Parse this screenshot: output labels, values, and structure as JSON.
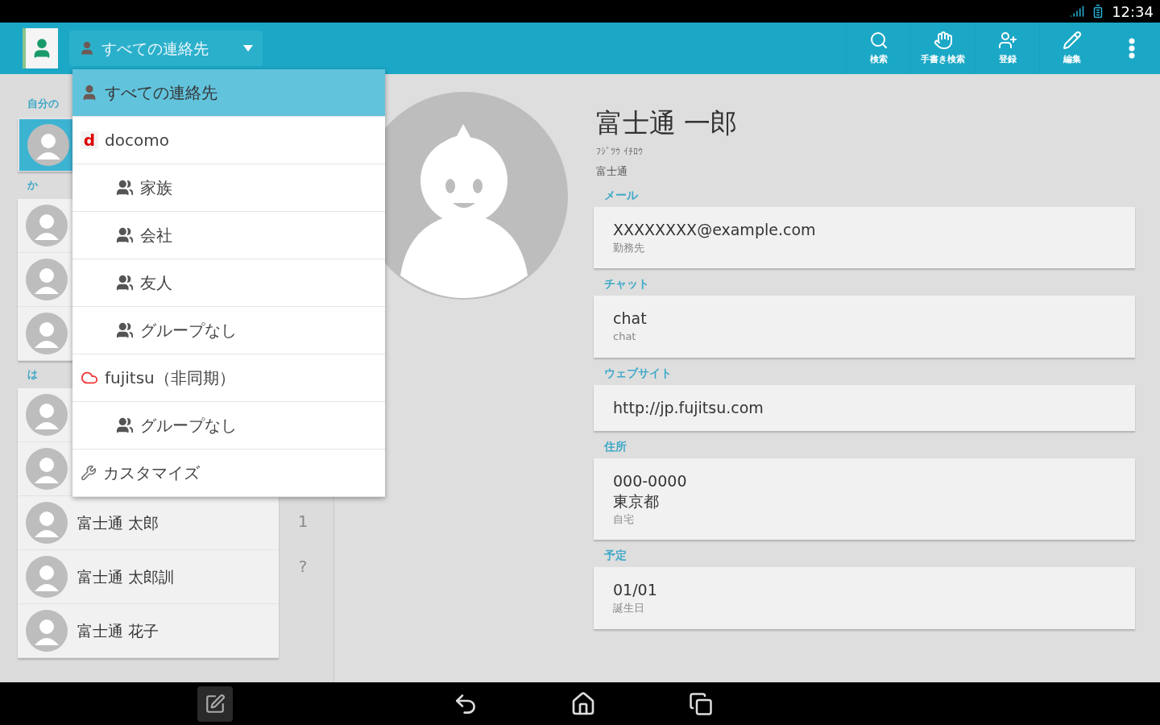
{
  "status_bar": {
    "time": "12:34"
  },
  "app_bar": {
    "filter": "すべての連絡先",
    "actions": [
      {
        "kind": "search",
        "label": "検索"
      },
      {
        "kind": "handwrite",
        "label": "手書き検索"
      },
      {
        "kind": "add",
        "label": "登録"
      },
      {
        "kind": "edit",
        "label": "編集"
      }
    ]
  },
  "contacts": {
    "sections": [
      {
        "header": "自分の",
        "rows": [
          {
            "selected": true
          }
        ]
      },
      {
        "header": "か",
        "rows": [
          {
            "selected": false
          },
          {
            "selected": false
          },
          {
            "selected": false
          }
        ]
      },
      {
        "header": "は",
        "rows": [
          {
            "selected": false
          },
          {
            "selected": false
          },
          {
            "name": "富士通 太郎",
            "selected": false
          },
          {
            "name": "富士通 太郎訓",
            "selected": false
          },
          {
            "name": "富士通 花子",
            "selected": false
          }
        ]
      }
    ],
    "index": [
      "1",
      "?"
    ]
  },
  "dropdown": {
    "items": [
      {
        "kind": "all",
        "label": "すべての連絡先",
        "selected": true
      },
      {
        "kind": "docomo",
        "logo": "d",
        "label": "docomo",
        "selected": false,
        "children": [
          {
            "kind": "group",
            "label": "家族",
            "selected": false
          },
          {
            "kind": "group",
            "label": "会社",
            "selected": false
          },
          {
            "kind": "group",
            "label": "友人",
            "selected": false
          },
          {
            "kind": "group",
            "label": "グループなし",
            "selected": false
          }
        ]
      },
      {
        "kind": "cloud",
        "label": "fujitsu（非同期）",
        "selected": false,
        "children": [
          {
            "kind": "group",
            "label": "グループなし",
            "selected": false
          }
        ]
      },
      {
        "kind": "customize",
        "label": "カスタマイズ",
        "selected": false
      }
    ]
  },
  "detail": {
    "name": "富士通 一郎",
    "phonetic": "ﾌｼﾞﾂｳ ｲﾁﾛｳ",
    "company": "富士通",
    "sections": [
      {
        "label": "メール",
        "lines": [
          "XXXXXXXX@example.com"
        ],
        "type": "勤務先"
      },
      {
        "label": "チャット",
        "lines": [
          "chat"
        ],
        "type": "chat"
      },
      {
        "label": "ウェブサイト",
        "lines": [
          "http://jp.fujitsu.com"
        ]
      },
      {
        "label": "住所",
        "lines": [
          "000-0000",
          "東京都"
        ],
        "type": "自宅"
      },
      {
        "label": "予定",
        "lines": [
          "01/01"
        ],
        "type": "誕生日"
      }
    ]
  }
}
